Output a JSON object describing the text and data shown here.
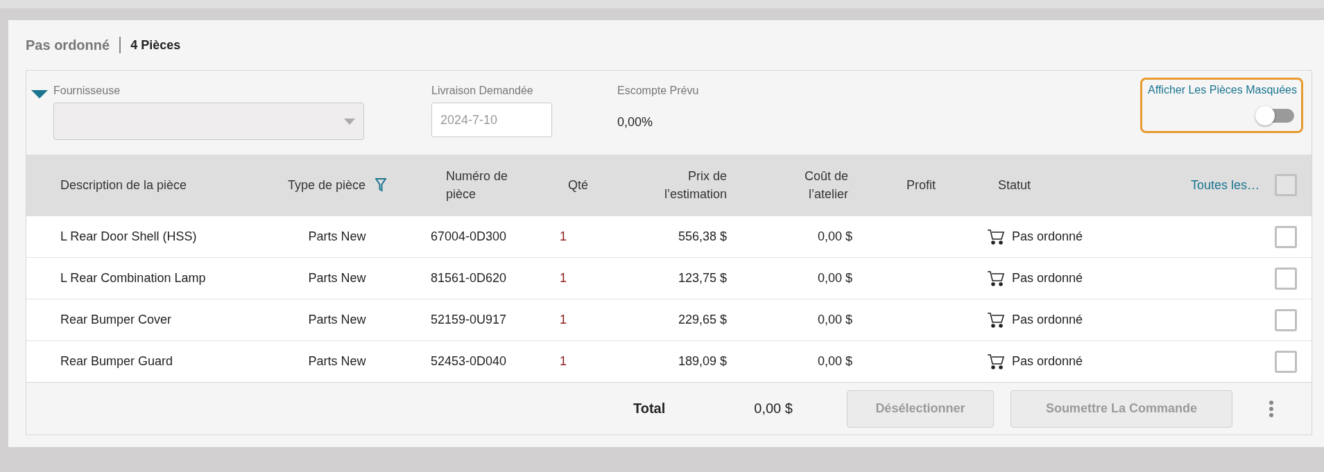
{
  "header": {
    "title": "Pas ordonné",
    "count": "4 Pièces"
  },
  "filters": {
    "expanded": true,
    "supplier": {
      "label": "Fournisseuse",
      "disabled": true
    },
    "delivery": {
      "label": "Livraison Demandée",
      "placeholder": "2024-7-10"
    },
    "discount": {
      "label": "Escompte Prévu",
      "value": "0,00%"
    },
    "show_hidden": {
      "label": "Afficher Les Pièces Masquées",
      "on": false,
      "highlighted": true
    }
  },
  "table": {
    "columns": [
      "Description de la pièce",
      "Type de pièce",
      "Numéro de pièce",
      "Qté",
      "Prix de l’estimation",
      "Coût de l’atelier",
      "Profit",
      "Statut",
      "Toutes les…"
    ],
    "select_all": {
      "checked": false
    },
    "rows": [
      {
        "description": "L Rear Door Shell (HSS)",
        "type": "Parts New",
        "number": "67004-0D300",
        "qty": "1",
        "price": "556,38 $",
        "cost": "0,00 $",
        "status": "Pas ordonné",
        "checked": false
      },
      {
        "description": "L Rear Combination Lamp",
        "type": "Parts New",
        "number": "81561-0D620",
        "qty": "1",
        "price": "123,75 $",
        "cost": "0,00 $",
        "status": "Pas ordonné",
        "checked": false
      },
      {
        "description": "Rear Bumper Cover",
        "type": "Parts New",
        "number": "52159-0U917",
        "qty": "1",
        "price": "229,65 $",
        "cost": "0,00 $",
        "status": "Pas ordonné",
        "checked": false
      },
      {
        "description": "Rear Bumper Guard",
        "type": "Parts New",
        "number": "52453-0D040",
        "qty": "1",
        "price": "189,09 $",
        "cost": "0,00 $",
        "status": "Pas ordonné",
        "checked": false
      }
    ]
  },
  "footer": {
    "total_label": "Total",
    "total": "0,00 $",
    "buttons": [
      {
        "label": "Désélectionner",
        "disabled": true
      },
      {
        "label": "Soumettre La Commande",
        "disabled": true
      }
    ]
  }
}
